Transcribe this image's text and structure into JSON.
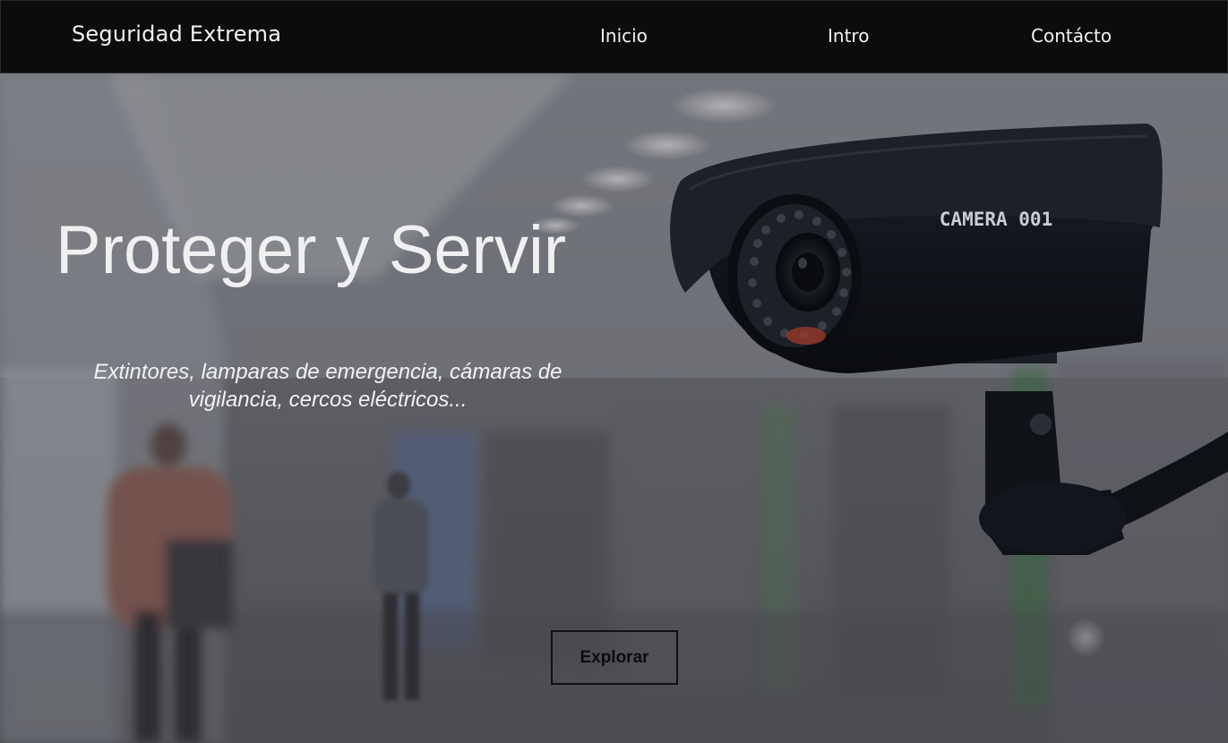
{
  "nav": {
    "brand": "Seguridad Extrema",
    "links": [
      {
        "label": "Inicio"
      },
      {
        "label": "Intro"
      },
      {
        "label": "Contácto"
      }
    ]
  },
  "hero": {
    "title": "Proteger y Servir",
    "subtitle": "Extintores, lamparas de emergencia, cámaras de vigilancia, cercos eléctricos...",
    "button_label": "Explorar",
    "camera_text": "CAMERA 001"
  },
  "colors": {
    "navbar": "#0c0c0c",
    "text_light": "#f2f2f2",
    "button_border": "#111111"
  }
}
